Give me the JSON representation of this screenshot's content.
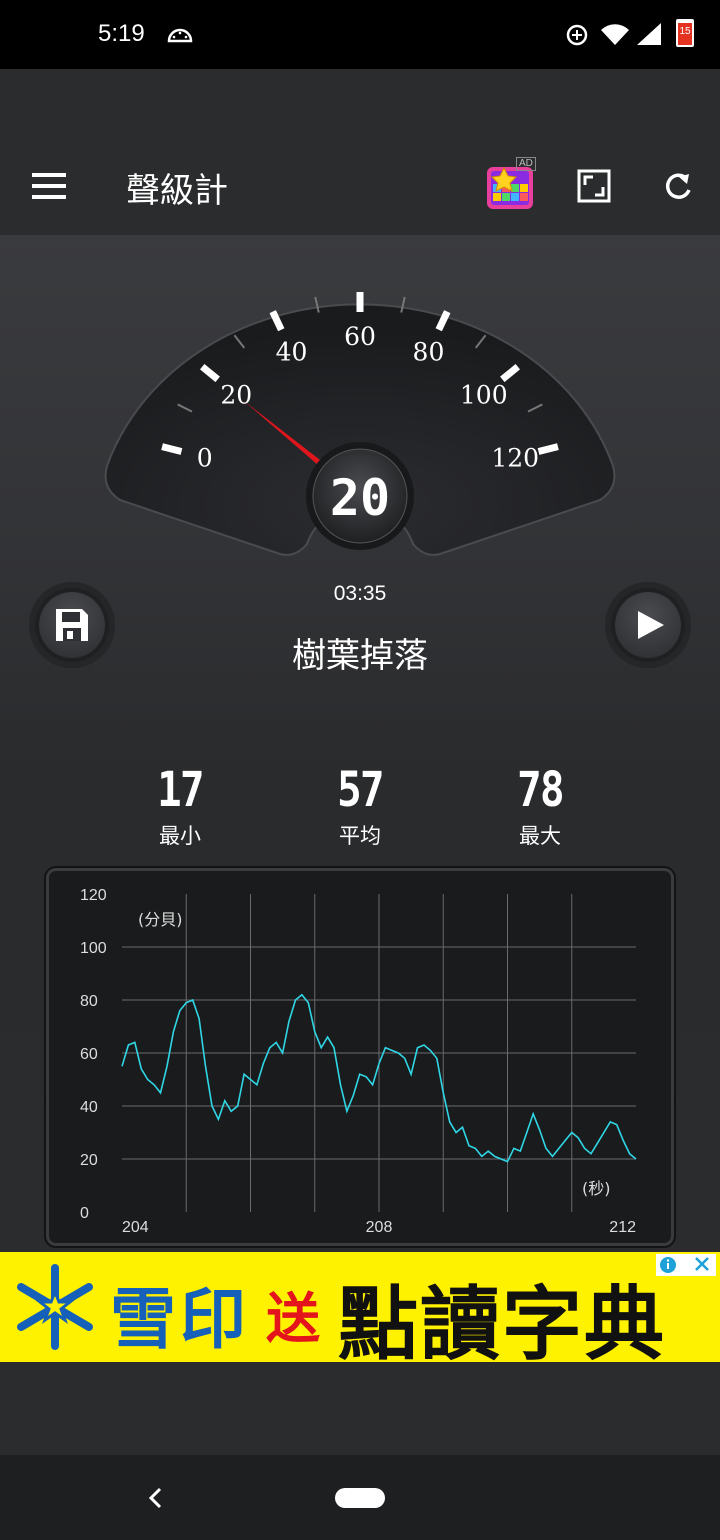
{
  "status_bar": {
    "time": "5:19",
    "battery_text": "15"
  },
  "toolbar": {
    "title": "聲級計",
    "ad_badge": "AD"
  },
  "gauge": {
    "reading": "20",
    "needle_value": 20,
    "scale_labels": [
      "0",
      "20",
      "40",
      "60",
      "80",
      "100",
      "120"
    ],
    "colors": {
      "needle": "#e0161d",
      "face": "#1d1e20"
    }
  },
  "timer": "03:35",
  "sound_label": "樹葉掉落",
  "stats": {
    "min": {
      "value": "17",
      "label": "最小"
    },
    "avg": {
      "value": "57",
      "label": "平均"
    },
    "max": {
      "value": "78",
      "label": "最大"
    }
  },
  "chart_data": {
    "type": "line",
    "ylabel": "(分貝)",
    "xlabel": "(秒)",
    "ylim": [
      0,
      120
    ],
    "xlim": [
      204,
      212
    ],
    "y_ticks": [
      "120",
      "100",
      "80",
      "60",
      "40",
      "20",
      "0"
    ],
    "x_ticks": [
      "204",
      "208",
      "212"
    ],
    "grid": true,
    "line_color": "#2fd7e6",
    "series": [
      {
        "x": [
          204.0,
          204.1,
          204.2,
          204.3,
          204.4,
          204.5,
          204.6,
          204.7,
          204.8,
          204.9,
          205.0,
          205.1,
          205.2,
          205.3,
          205.4,
          205.5,
          205.6,
          205.7,
          205.8,
          205.9,
          206.0,
          206.1,
          206.2,
          206.3,
          206.4,
          206.5,
          206.6,
          206.7,
          206.8,
          206.9,
          207.0,
          207.1,
          207.2,
          207.3,
          207.4,
          207.5,
          207.6,
          207.7,
          207.8,
          207.9,
          208.0,
          208.1,
          208.2,
          208.3,
          208.4,
          208.5,
          208.6,
          208.7,
          208.8,
          208.9,
          209.0,
          209.1,
          209.2,
          209.3,
          209.4,
          209.5,
          209.6,
          209.7,
          209.8,
          209.9,
          210.0,
          210.1,
          210.2,
          210.3,
          210.4,
          210.5,
          210.6,
          210.7,
          210.8,
          210.9,
          211.0,
          211.1,
          211.2,
          211.3,
          211.4,
          211.5,
          211.6,
          211.7,
          211.8,
          211.9,
          212.0
        ],
        "values": [
          55,
          63,
          64,
          54,
          50,
          48,
          45,
          55,
          68,
          76,
          79,
          80,
          73,
          55,
          40,
          35,
          42,
          38,
          40,
          52,
          50,
          48,
          56,
          62,
          64,
          60,
          72,
          80,
          82,
          79,
          68,
          62,
          66,
          62,
          48,
          38,
          44,
          52,
          51,
          48,
          56,
          62,
          61,
          60,
          58,
          52,
          62,
          63,
          61,
          58,
          45,
          34,
          30,
          32,
          25,
          24,
          21,
          23,
          21,
          20,
          19,
          24,
          23,
          30,
          37,
          31,
          24,
          21,
          24,
          27,
          30,
          28,
          24,
          22,
          26,
          30,
          34,
          33,
          27,
          22,
          20
        ]
      }
    ]
  },
  "ad": {
    "brand": "雪印",
    "send": "送",
    "headline": "點讀字典",
    "colors": {
      "background": "#fff200",
      "brand": "#1560b8",
      "accent": "#e4141c"
    }
  }
}
